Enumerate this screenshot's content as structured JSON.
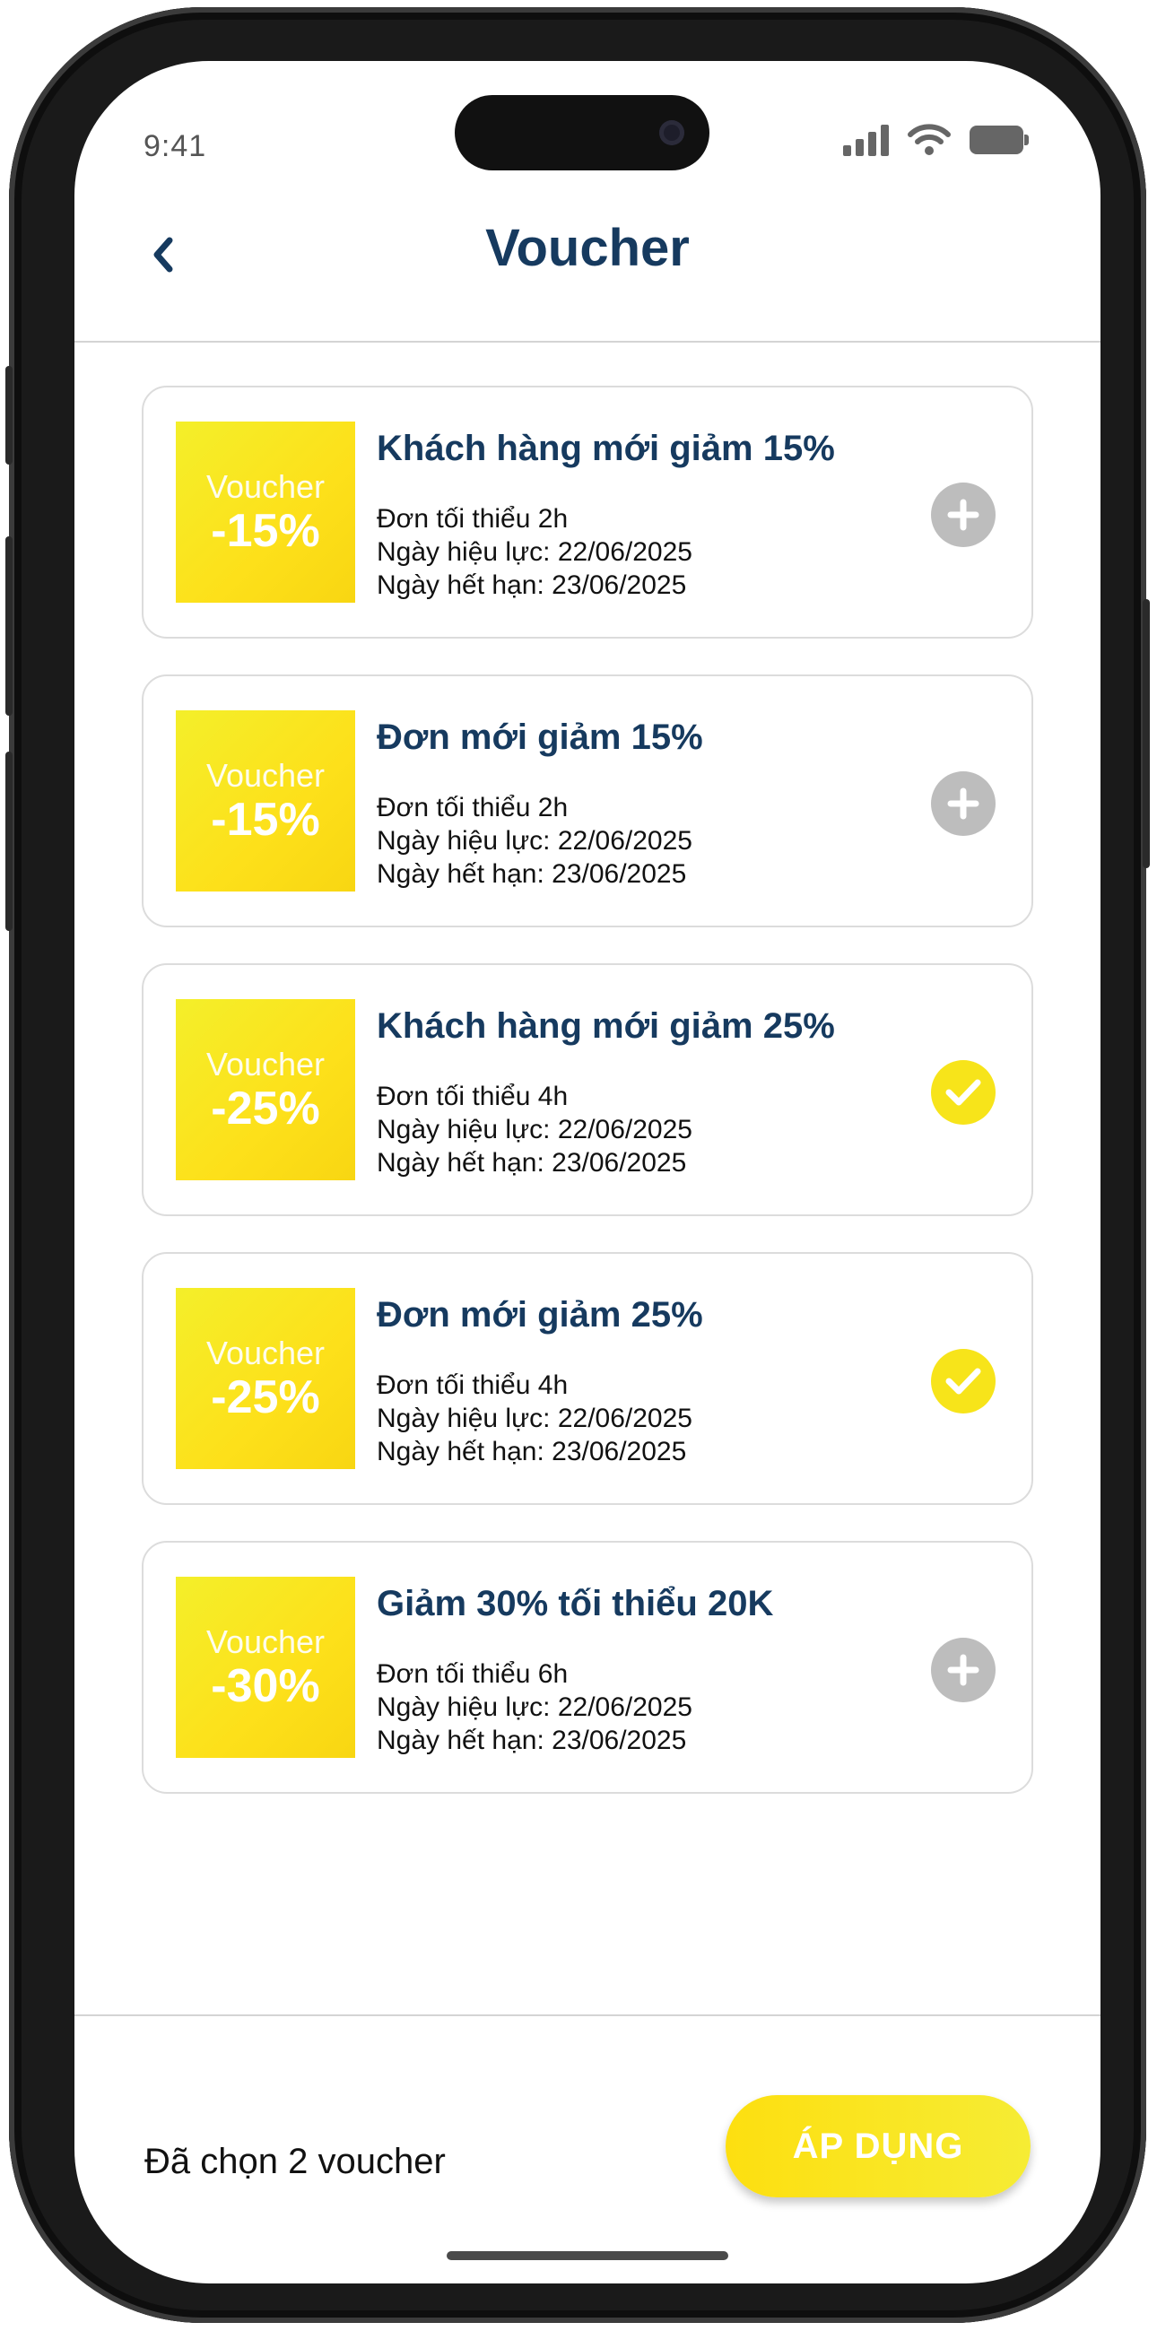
{
  "status_bar": {
    "time": "9:41"
  },
  "header": {
    "title": "Voucher",
    "back_icon": "chevron-left-icon"
  },
  "vouchers": [
    {
      "label": "Voucher",
      "value": "-15%",
      "title": "Khách hàng mới giảm 15%",
      "min_order": "Đơn tối thiểu 2h",
      "valid_from": "Ngày hiệu lực: 22/06/2025",
      "expires": "Ngày hết hạn: 23/06/2025",
      "selected": false
    },
    {
      "label": "Voucher",
      "value": "-15%",
      "title": "Đơn mới giảm 15%",
      "min_order": "Đơn tối thiểu 2h",
      "valid_from": "Ngày hiệu lực: 22/06/2025",
      "expires": "Ngày hết hạn: 23/06/2025",
      "selected": false
    },
    {
      "label": "Voucher",
      "value": "-25%",
      "title": "Khách hàng mới giảm 25%",
      "min_order": "Đơn tối thiểu 4h",
      "valid_from": "Ngày hiệu lực: 22/06/2025",
      "expires": "Ngày hết hạn: 23/06/2025",
      "selected": true
    },
    {
      "label": "Voucher",
      "value": "-25%",
      "title": "Đơn mới giảm 25%",
      "min_order": "Đơn tối thiểu 4h",
      "valid_from": "Ngày hiệu lực: 22/06/2025",
      "expires": "Ngày hết hạn: 23/06/2025",
      "selected": true
    },
    {
      "label": "Voucher",
      "value": "-30%",
      "title": "Giảm 30% tối thiểu 20K",
      "min_order": "Đơn tối thiểu 6h",
      "valid_from": "Ngày hiệu lực: 22/06/2025",
      "expires": "Ngày hết hạn: 23/06/2025",
      "selected": false
    }
  ],
  "footer": {
    "selected_text": "Đã chọn 2 voucher",
    "apply_label": "ÁP DỤNG"
  },
  "colors": {
    "accent_yellow": "#f7e41a",
    "title_navy": "#163a5f",
    "inactive_gray": "#bdbdbd"
  }
}
